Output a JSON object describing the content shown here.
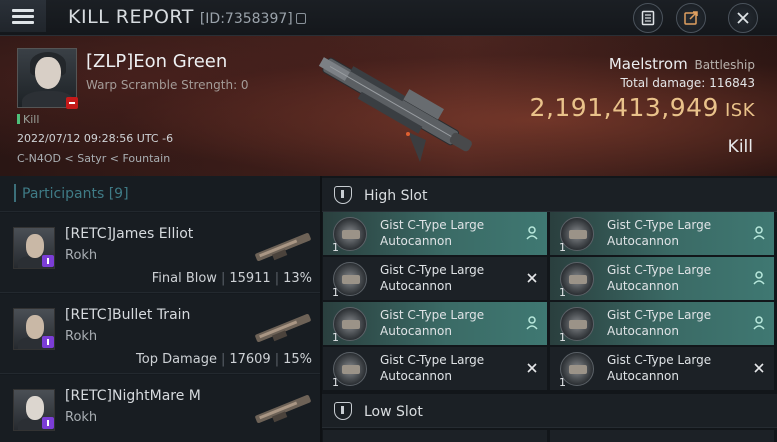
{
  "header": {
    "title": "KILL REPORT",
    "id": "[ID:7358397]",
    "icons": [
      "menu-icon",
      "copy-icon",
      "document-icon",
      "share-icon",
      "close-icon"
    ]
  },
  "victim": {
    "name": "[ZLP]Eon Green",
    "warp_scramble": "Warp Scramble Strength: 0",
    "kill_tag": "Kill",
    "datetime": "2022/07/12 09:28:56 UTC -6",
    "location": "C-N4OD < Satyr < Fountain",
    "ship_name": "Maelstrom",
    "ship_class": "Battleship",
    "total_damage_label": "Total damage:",
    "total_damage": "116843",
    "isk_value": "2,191,413,949",
    "isk_unit": "ISK",
    "result": "Kill"
  },
  "participants": {
    "label": "Participants",
    "count": "[9]",
    "items": [
      {
        "name": "[RETC]James Elliot",
        "ship": "Rokh",
        "stat_label": "Final Blow",
        "damage": "15911",
        "percent": "13%"
      },
      {
        "name": "[RETC]Bullet Train",
        "ship": "Rokh",
        "stat_label": "Top Damage",
        "damage": "17609",
        "percent": "15%"
      },
      {
        "name": "[RETC]NightMare M",
        "ship": "Rokh",
        "stat_label": "",
        "damage": "",
        "percent": ""
      }
    ]
  },
  "fitting": {
    "high_slot_label": "High Slot",
    "low_slot_label": "Low Slot",
    "high_modules": [
      {
        "qty": "1",
        "name": "Gist C-Type Large Autocannon",
        "state": "dropped"
      },
      {
        "qty": "1",
        "name": "Gist C-Type Large Autocannon",
        "state": "dropped"
      },
      {
        "qty": "1",
        "name": "Gist C-Type Large Autocannon",
        "state": "destroyed"
      },
      {
        "qty": "1",
        "name": "Gist C-Type Large Autocannon",
        "state": "dropped"
      },
      {
        "qty": "1",
        "name": "Gist C-Type Large Autocannon",
        "state": "dropped"
      },
      {
        "qty": "1",
        "name": "Gist C-Type Large Autocannon",
        "state": "dropped"
      },
      {
        "qty": "1",
        "name": "Gist C-Type Large Autocannon",
        "state": "destroyed"
      },
      {
        "qty": "1",
        "name": "Gist C-Type Large Autocannon",
        "state": "destroyed"
      }
    ]
  },
  "colors": {
    "accent_teal": "#3f7b86",
    "isk_gold": "#e9c28a",
    "dropped_module": "#3b6b66",
    "badge_purple": "#7b3dd6",
    "badge_red": "#c41a1a"
  }
}
